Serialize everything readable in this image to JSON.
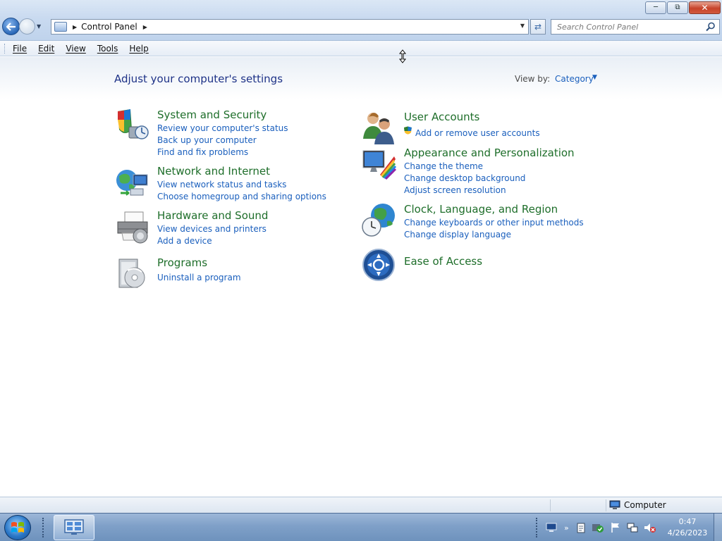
{
  "window": {
    "caption_buttons": [
      "minimize-icon",
      "maximize-icon",
      "close-icon"
    ]
  },
  "address_bar": {
    "breadcrumb": "Control Panel",
    "search_placeholder": "Search Control Panel"
  },
  "menu": [
    "File",
    "Edit",
    "View",
    "Tools",
    "Help"
  ],
  "content": {
    "heading": "Adjust your computer's settings",
    "view_by_label": "View by:",
    "view_by_value": "Category",
    "categories": [
      {
        "title": "System and Security",
        "icon": "shield-icon",
        "links": [
          "Review your computer's status",
          "Back up your computer",
          "Find and fix problems"
        ]
      },
      {
        "title": "Network and Internet",
        "icon": "globe-network-icon",
        "links": [
          "View network status and tasks",
          "Choose homegroup and sharing options"
        ]
      },
      {
        "title": "Hardware and Sound",
        "icon": "printer-icon",
        "links": [
          "View devices and printers",
          "Add a device"
        ]
      },
      {
        "title": "Programs",
        "icon": "programs-disc-icon",
        "links": [
          "Uninstall a program"
        ]
      },
      {
        "title": "User Accounts",
        "icon": "users-icon",
        "links": [
          "Add or remove user accounts"
        ]
      },
      {
        "title": "Appearance and Personalization",
        "icon": "monitor-palette-icon",
        "links": [
          "Change the theme",
          "Change desktop background",
          "Adjust screen resolution"
        ]
      },
      {
        "title": "Clock, Language, and Region",
        "icon": "clock-globe-icon",
        "links": [
          "Change keyboards or other input methods",
          "Change display language"
        ]
      },
      {
        "title": "Ease of Access",
        "icon": "ease-of-access-icon",
        "links": []
      }
    ]
  },
  "statusbar": {
    "location": "Computer"
  },
  "taskbar": {
    "time": "0:47",
    "date": "4/26/2023"
  },
  "colors": {
    "link": "#1a5fbd",
    "category_title": "#1e6e2a",
    "heading": "#1e3287"
  }
}
